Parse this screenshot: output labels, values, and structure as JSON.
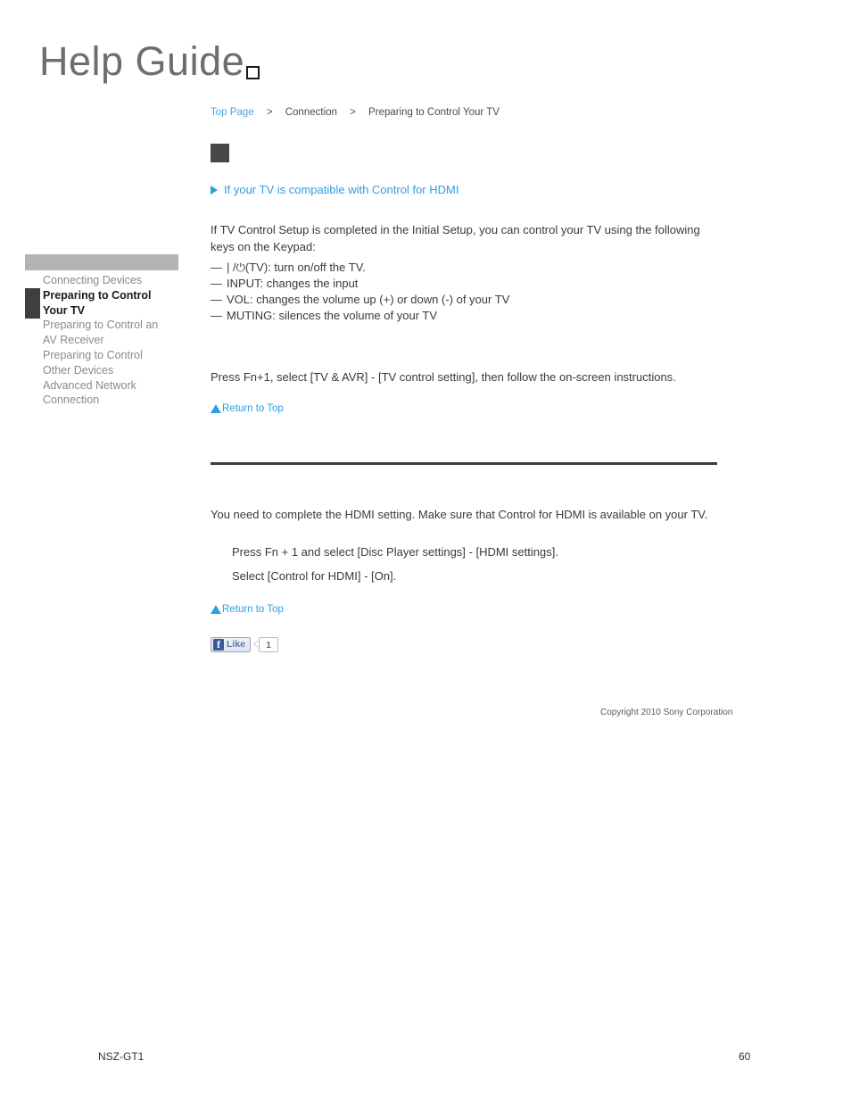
{
  "logo": {
    "title": "Help Guide",
    "broken_image_icon": "broken-image-icon"
  },
  "breadcrumb": {
    "top_page": "Top Page",
    "separator": ">",
    "section": "Connection",
    "current": "Preparing to Control Your TV"
  },
  "heading": {
    "placeholder_image": "missing-image-placeholder"
  },
  "sidebar": {
    "items": [
      {
        "label": "Connecting Devices",
        "active": false
      },
      {
        "label": "Preparing to Control Your TV",
        "active": true
      },
      {
        "label": "Preparing to Control an AV Receiver",
        "active": false
      },
      {
        "label": "Preparing to Control Other Devices",
        "active": false
      },
      {
        "label": "Advanced Network Connection",
        "active": false
      }
    ]
  },
  "main": {
    "hdmi_link": "If your TV is compatible with Control for HDMI",
    "intro_paragraph": "If TV Control Setup is completed in the Initial Setup, you can control your TV using the following keys on the Keypad:",
    "key_list": [
      {
        "bullet": "—",
        "text_prefix": "| / ",
        "glyph": "⏻",
        "text": " (TV): turn on/off the TV."
      },
      {
        "bullet": "—",
        "text_prefix": "",
        "glyph": "",
        "text": "INPUT: changes the input"
      },
      {
        "bullet": "—",
        "text_prefix": "",
        "glyph": "",
        "text": "VOL: changes the volume up (+) or down (-) of your TV"
      },
      {
        "bullet": "—",
        "text_prefix": "",
        "glyph": "",
        "text": "MUTING: silences the volume of your TV"
      }
    ],
    "press_paragraph": "Press Fn+1, select [TV & AVR] - [TV control setting], then follow the on-screen instructions.",
    "return_to_top_1": "Return to Top",
    "hdmi_paragraph": "You need to complete the HDMI setting. Make sure that Control for HDMI is available on your TV.",
    "steps": [
      "Press Fn + 1 and select [Disc Player settings] - [HDMI settings].",
      "Select [Control for HDMI] - [On]."
    ],
    "return_to_top_2": "Return to Top"
  },
  "social": {
    "facebook_icon": "f",
    "like_label": "Like",
    "like_count": "1"
  },
  "footer": {
    "copyright": "Copyright 2010 Sony Corporation",
    "model": "NSZ-GT1",
    "page_number": "60"
  },
  "colors": {
    "link_blue": "#2e9fe0",
    "breadcrumb_blue": "#4aa3df",
    "sidebar_bar": "#b3b3b3",
    "active_marker": "#3f3f3f",
    "rule": "#3d3d3d",
    "facebook_blue": "#3b5998"
  }
}
